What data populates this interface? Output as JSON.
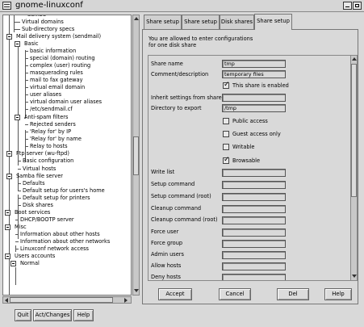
{
  "window": {
    "title": "gnome-linuxconf"
  },
  "tree": {
    "items": [
      {
        "label": "Virtual domains"
      },
      {
        "label": "Sub-directory specs"
      },
      {
        "label": "Mail delivery system (sendmail)"
      },
      {
        "label": "Basic"
      },
      {
        "label": "basic information"
      },
      {
        "label": "special (domain) routing"
      },
      {
        "label": "complex (user) routing"
      },
      {
        "label": "masquerading rules"
      },
      {
        "label": "mail to fax gateway"
      },
      {
        "label": "virtual email domain"
      },
      {
        "label": "user aliases"
      },
      {
        "label": "virtual domain user aliases"
      },
      {
        "label": "/etc/sendmail.cf"
      },
      {
        "label": "Anti-spam filters"
      },
      {
        "label": "Rejected senders"
      },
      {
        "label": "'Relay for' by IP"
      },
      {
        "label": "'Relay for' by name"
      },
      {
        "label": "Relay to hosts"
      },
      {
        "label": "Ftp server (wu-ftpd)"
      },
      {
        "label": "Basic configuration"
      },
      {
        "label": "Virtual hosts"
      },
      {
        "label": "Samba file server"
      },
      {
        "label": "Defaults"
      },
      {
        "label": "Default setup for users's home"
      },
      {
        "label": "Default setup for printers"
      },
      {
        "label": "Disk shares"
      },
      {
        "label": "Boot services"
      },
      {
        "label": "DHCP/BOOTP server"
      },
      {
        "label": "Misc"
      },
      {
        "label": "Information about other hosts"
      },
      {
        "label": "Information about other networks"
      },
      {
        "label": "Linuxconf network access"
      },
      {
        "label": "Users accounts"
      },
      {
        "label": "Normal"
      }
    ]
  },
  "bottom_buttons": {
    "quit": "Quit",
    "act_changes": "Act/Changes",
    "help": "Help"
  },
  "tabs": [
    {
      "label": "Share setup"
    },
    {
      "label": "Share setup"
    },
    {
      "label": "Disk shares"
    },
    {
      "label": "Share setup"
    }
  ],
  "intro": {
    "line1": "You are allowed to enter configurations",
    "line2": "for one disk share"
  },
  "form": {
    "share_name": {
      "label": "Share name",
      "value": "tmp"
    },
    "comment": {
      "label": "Comment/description",
      "value": "temporary files"
    },
    "enabled": {
      "label": "This share is enabled",
      "checked": true
    },
    "inherit": {
      "label": "Inherit settings from share",
      "value": ""
    },
    "directory": {
      "label": "Directory to export",
      "value": "/tmp"
    },
    "public": {
      "label": "Public access",
      "checked": false
    },
    "guest_only": {
      "label": "Guest access only",
      "checked": false
    },
    "writable": {
      "label": "Writable",
      "checked": false
    },
    "browsable": {
      "label": "Browsable",
      "checked": true
    },
    "write_list": {
      "label": "Write list",
      "value": ""
    },
    "setup_command": {
      "label": "Setup command",
      "value": ""
    },
    "setup_command_root": {
      "label": "Setup command (root)",
      "value": ""
    },
    "cleanup_command": {
      "label": "Cleanup command",
      "value": ""
    },
    "cleanup_command_root": {
      "label": "Cleanup command (root)",
      "value": ""
    },
    "force_user": {
      "label": "Force user",
      "value": ""
    },
    "force_group": {
      "label": "Force group",
      "value": ""
    },
    "admin_users": {
      "label": "Admin users",
      "value": ""
    },
    "allow_hosts": {
      "label": "Allow hosts",
      "value": ""
    },
    "deny_hosts": {
      "label": "Deny hosts",
      "value": ""
    }
  },
  "actions": {
    "accept": "Accept",
    "cancel": "Cancel",
    "del": "Del",
    "help": "Help"
  }
}
